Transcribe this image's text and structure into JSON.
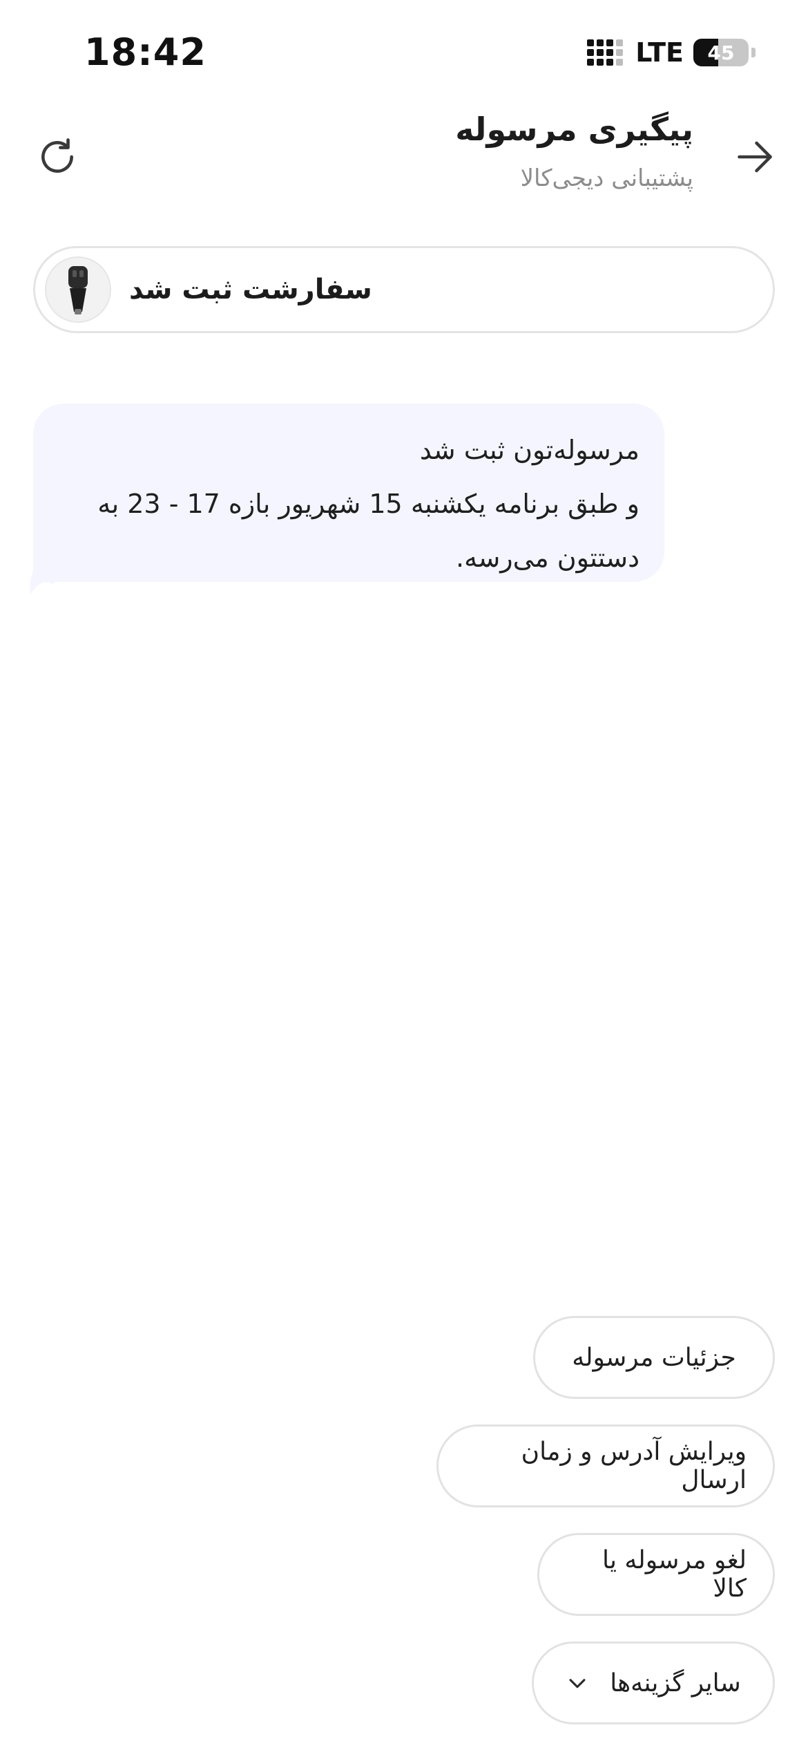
{
  "status_bar": {
    "time": "18:42",
    "network": "LTE",
    "battery": "45",
    "battery_level": 0.45
  },
  "header": {
    "title": "پیگیری مرسوله",
    "subtitle": "پشتیبانی دیجی‌کالا",
    "back_icon": "arrow-right-icon",
    "refresh_icon": "refresh-icon"
  },
  "order": {
    "label": "سفارشت ثبت شد",
    "thumbnail_icon": "car-charger-icon"
  },
  "message": {
    "line1": "مرسوله‌تون ثبت شد",
    "line2": "و طبق برنامه یکشنبه 15 شهریور بازه 17 - 23 به",
    "line3": "دستتون می‌رسه."
  },
  "actions": {
    "details": "جزئیات مرسوله",
    "edit": "ویرایش آدرس و زمان ارسال",
    "cancel": "لغو مرسوله یا کالا",
    "more": "سایر گزینه‌ها",
    "more_icon": "chevron-down-icon"
  },
  "colors": {
    "bubble_bg": "#f4f5fe",
    "border": "#e2e2e2",
    "muted_text": "#8c8c8c"
  }
}
